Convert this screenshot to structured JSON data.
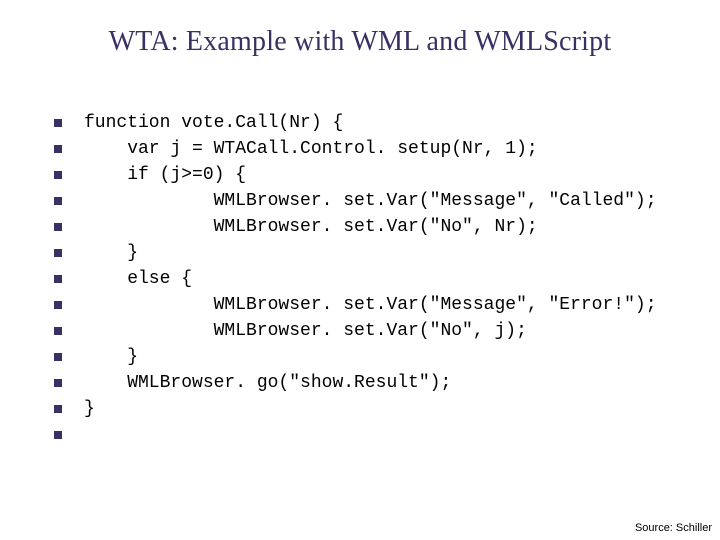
{
  "title": "WTA: Example with WML and WMLScript",
  "code_lines": [
    "function vote.Call(Nr) {",
    "    var j = WTACall.Control. setup(Nr, 1);",
    "    if (j>=0) {",
    "            WMLBrowser. set.Var(\"Message\", \"Called\");",
    "            WMLBrowser. set.Var(\"No\", Nr);",
    "    }",
    "    else {",
    "            WMLBrowser. set.Var(\"Message\", \"Error!\");",
    "            WMLBrowser. set.Var(\"No\", j);",
    "    }",
    "    WMLBrowser. go(\"show.Result\");",
    "}",
    ""
  ],
  "source_label": "Source: Schiller"
}
